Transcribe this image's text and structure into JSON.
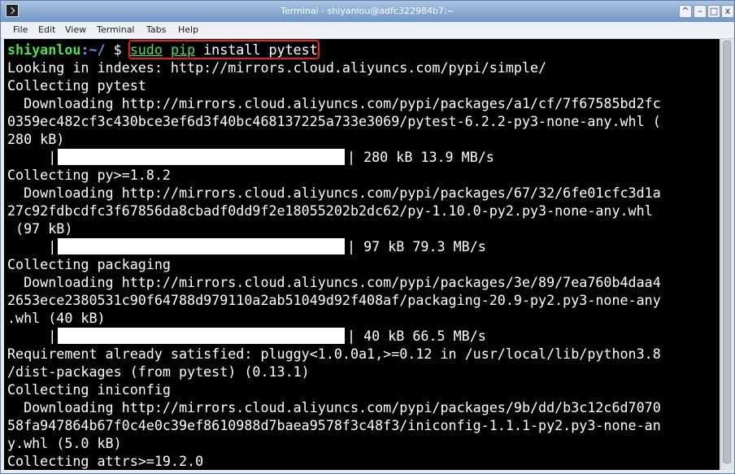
{
  "window": {
    "title": "Terminal - shiyanlou@adfc322984b7:~",
    "buttons": [
      "^",
      "–",
      "□",
      "x"
    ]
  },
  "menu": [
    "File",
    "Edit",
    "View",
    "Terminal",
    "Tabs",
    "Help"
  ],
  "prompt": {
    "user": "shiyanlou",
    "colon": ":",
    "path": "~/",
    "symbol": " $",
    "cmd_sudo": "sudo",
    "cmd_pip": "pip",
    "cmd_rest": " install pytest"
  },
  "lines": [
    "Looking in indexes: http://mirrors.cloud.aliyuncs.com/pypi/simple/",
    "Collecting pytest",
    "  Downloading http://mirrors.cloud.aliyuncs.com/pypi/packages/a1/cf/7f67585bd2fc",
    "0359ec482cf3c430bce3ef6d3f40bc468137225a733e3069/pytest-6.2.2-py3-none-any.whl (",
    "280 kB)",
    "     |",
    "Collecting py>=1.8.2",
    "  Downloading http://mirrors.cloud.aliyuncs.com/pypi/packages/67/32/6fe01cfc3d1a",
    "27c92fdbcdfc3f67856da8cbadf0dd9f2e18055202b2dc62/py-1.10.0-py2.py3-none-any.whl",
    " (97 kB)",
    "     |",
    "Collecting packaging",
    "  Downloading http://mirrors.cloud.aliyuncs.com/pypi/packages/3e/89/7ea760b4daa4",
    "2653ece2380531c90f64788d979110a2ab51049d92f408af/packaging-20.9-py2.py3-none-any",
    ".whl (40 kB)",
    "     |",
    "Requirement already satisfied: pluggy<1.0.0a1,>=0.12 in /usr/local/lib/python3.8",
    "/dist-packages (from pytest) (0.13.1)",
    "Collecting iniconfig",
    "  Downloading http://mirrors.cloud.aliyuncs.com/pypi/packages/9b/dd/b3c12c6d7070",
    "58fa947864b67f0c4e0c39ef8610988d7baea9578f3c48f3/iniconfig-1.1.1-py2.py3-none-an",
    "y.whl (5.0 kB)",
    "Collecting attrs>=19.2.0"
  ],
  "progress": [
    {
      "fraction": 1.0,
      "text": "| 280 kB 13.9 MB/s"
    },
    {
      "fraction": 1.0,
      "text": "| 97 kB 79.3 MB/s"
    },
    {
      "fraction": 1.0,
      "text": "| 40 kB 66.5 MB/s"
    }
  ]
}
